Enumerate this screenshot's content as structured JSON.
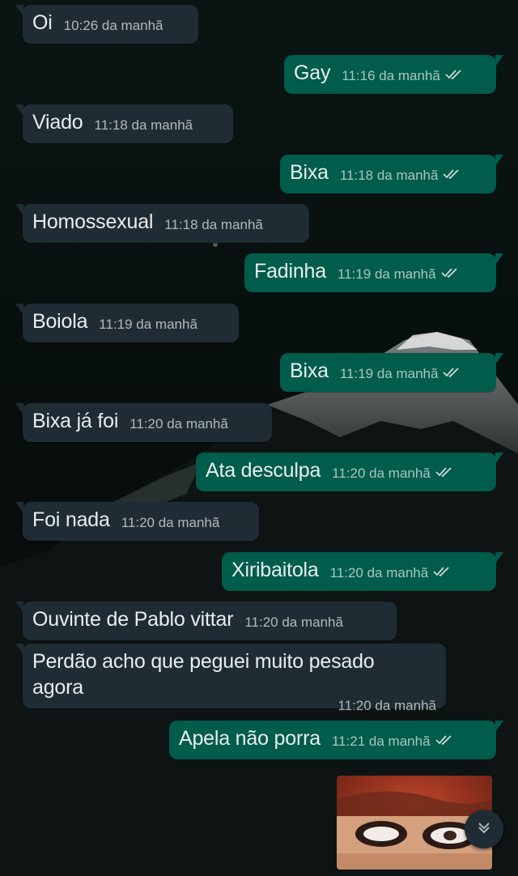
{
  "messages": [
    {
      "text": "Oi",
      "time": "10:26 da manhã",
      "direction": "in"
    },
    {
      "text": "Gay",
      "time": "11:16 da manhã",
      "direction": "out",
      "status": "read"
    },
    {
      "text": "Viado",
      "time": "11:18 da manhã",
      "direction": "in"
    },
    {
      "text": "Bixa",
      "time": "11:18 da manhã",
      "direction": "out",
      "status": "read"
    },
    {
      "text": "Homossexual",
      "time": "11:18 da manhã",
      "direction": "in"
    },
    {
      "text": "Fadinha",
      "time": "11:19 da manhã",
      "direction": "out",
      "status": "read"
    },
    {
      "text": "Boiola",
      "time": "11:19 da manhã",
      "direction": "in"
    },
    {
      "text": "Bixa",
      "time": "11:19 da manhã",
      "direction": "out",
      "status": "read"
    },
    {
      "text": "Bixa já foi",
      "time": "11:20 da manhã",
      "direction": "in"
    },
    {
      "text": "Ata desculpa",
      "time": "11:20 da manhã",
      "direction": "out",
      "status": "read"
    },
    {
      "text": "Foi nada",
      "time": "11:20 da manhã",
      "direction": "in"
    },
    {
      "text": "Xiribaitola",
      "time": "11:20 da manhã",
      "direction": "out",
      "status": "read"
    },
    {
      "text": "Ouvinte de Pablo vittar",
      "time": "11:20 da manhã",
      "direction": "in"
    },
    {
      "text": "Perdão acho que peguei muito pesado agora",
      "time": "11:20 da manhã",
      "direction": "in"
    },
    {
      "text": "Apela não porra",
      "time": "11:21 da manhã",
      "direction": "out",
      "status": "read"
    }
  ],
  "image_message": {
    "icon": "photo-thumbnail"
  },
  "scroll_button": {
    "icon": "double-chevron-down-icon"
  },
  "colors": {
    "incoming_bubble": "#1f2c33",
    "outgoing_bubble": "#005c4b",
    "read_ticks": "#cfd8dc",
    "background": "#0b1412"
  }
}
